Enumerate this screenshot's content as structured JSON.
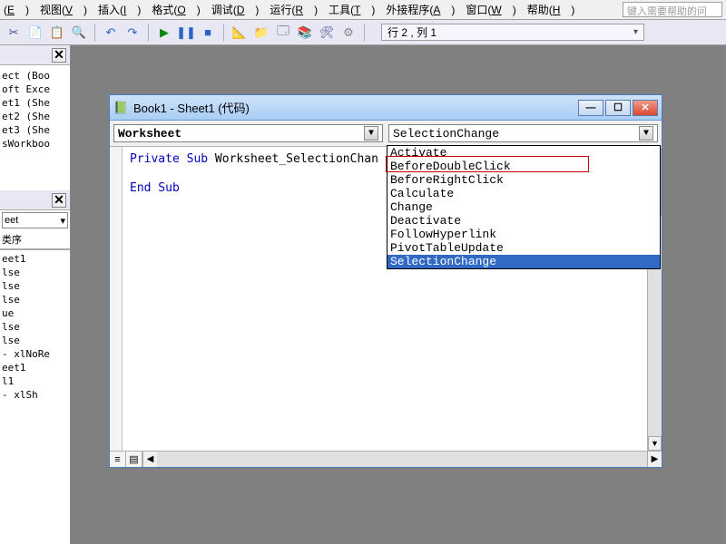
{
  "menu": {
    "items": [
      {
        "label": "(E)",
        "u": "E"
      },
      {
        "label": "视图(V)",
        "u": "V"
      },
      {
        "label": "插入(I)",
        "u": "I"
      },
      {
        "label": "格式(O)",
        "u": "O"
      },
      {
        "label": "调试(D)",
        "u": "D"
      },
      {
        "label": "运行(R)",
        "u": "R"
      },
      {
        "label": "工具(T)",
        "u": "T"
      },
      {
        "label": "外接程序(A)",
        "u": "A"
      },
      {
        "label": "窗口(W)",
        "u": "W"
      },
      {
        "label": "帮助(H)",
        "u": "H"
      }
    ],
    "help_placeholder": "键入需要帮助的问"
  },
  "toolbar": {
    "status": "行 2 , 列 1"
  },
  "left": {
    "tree": [
      "ect (Boo",
      "oft Exce",
      "et1 (She",
      "et2 (She",
      "et3 (She",
      "sWorkboo"
    ],
    "combo": "eet",
    "section_label": "类序",
    "list": [
      "eet1",
      "lse",
      "lse",
      "lse",
      "ue",
      "lse",
      "lse",
      "- xlNoRe",
      "eet1",
      "",
      "l1",
      "- xlSh"
    ]
  },
  "codewin": {
    "title": "Book1 - Sheet1 (代码)",
    "object_combo": "Worksheet",
    "event_combo": "SelectionChange",
    "code_line1_kw1": "Private Sub",
    "code_line1_rest": " Worksheet_SelectionChan",
    "code_line2": "End Sub"
  },
  "dropdown": {
    "options": [
      "Activate",
      "BeforeDoubleClick",
      "BeforeRightClick",
      "Calculate",
      "Change",
      "Deactivate",
      "FollowHyperlink",
      "PivotTableUpdate",
      "SelectionChange"
    ],
    "selected_index": 8,
    "highlight_index": 1
  }
}
